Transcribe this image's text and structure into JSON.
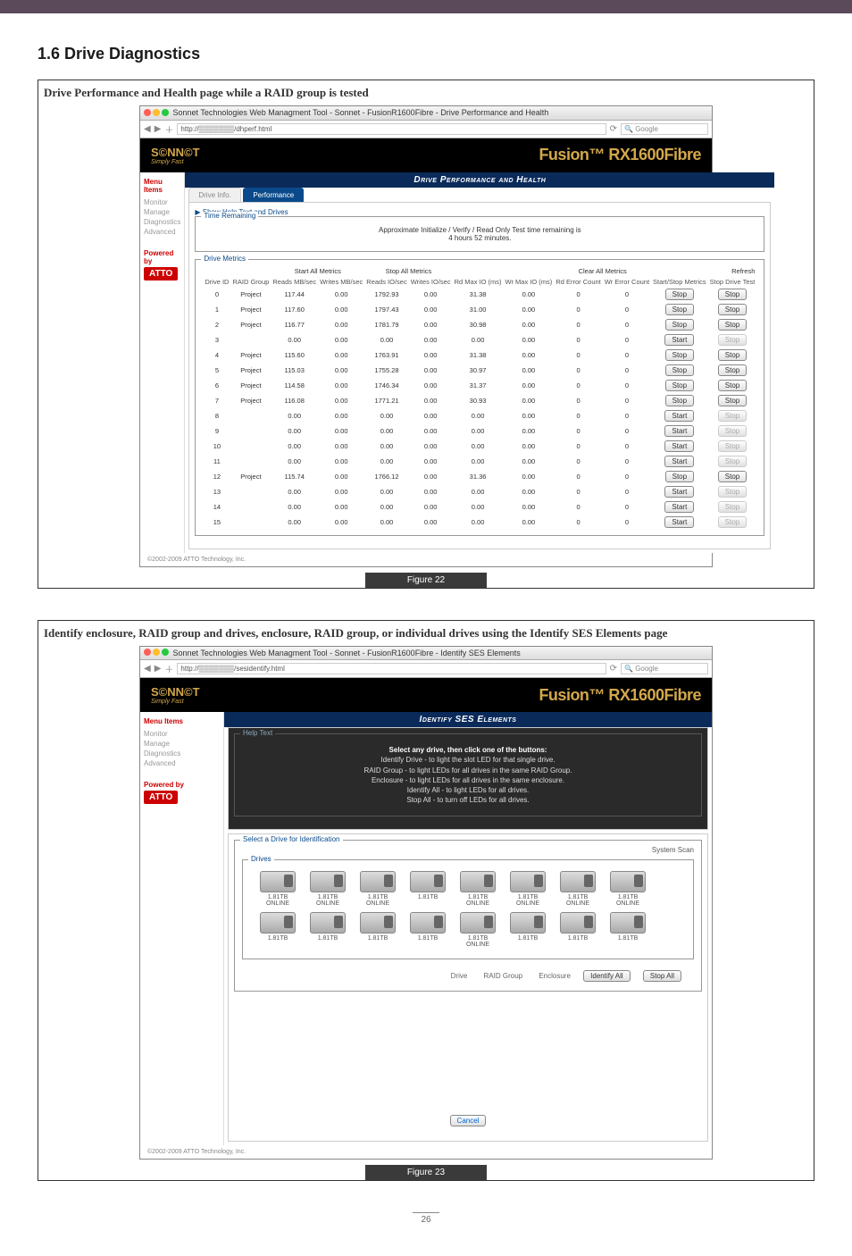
{
  "page": {
    "section_title": "1.6 Drive Diagnostics",
    "page_number": "26"
  },
  "fig1": {
    "caption": "Drive Performance and Health page while a RAID group is tested",
    "window_title": "Sonnet Technologies Web Managment Tool - Sonnet - FusionR1600Fibre - Drive Performance and Health",
    "url": "http://▒▒▒▒▒▒▒/dhperf.html",
    "search_placeholder": "Google",
    "brand": "S©NN©T",
    "brand_sub": "Simply Fast",
    "product": "Fusion™ RX1600Fibre",
    "sidebar": {
      "header": "Menu Items",
      "items": [
        "Monitor",
        "Manage",
        "Diagnostics",
        "Advanced"
      ],
      "powered": "Powered by",
      "atto": "ATTO"
    },
    "blueheader": "Drive Performance and Health",
    "tabs": [
      "Drive Info.",
      "Performance"
    ],
    "show_help": "Show Help Text and Drives",
    "time_remaining": {
      "legend": "Time Remaining",
      "line1": "Approximate Initialize / Verify / Read Only Test time remaining is",
      "line2": "4 hours 52 minutes."
    },
    "metrics": {
      "legend": "Drive Metrics",
      "group_headers": [
        "Start All Metrics",
        "Stop All Metrics",
        "Clear All Metrics",
        "Refresh"
      ],
      "cols": [
        "Drive ID",
        "RAID Group",
        "Reads MB/sec",
        "Writes MB/sec",
        "Reads IO/sec",
        "Writes IO/sec",
        "Rd Max IO (ms)",
        "Wr Max IO (ms)",
        "Rd Error Count",
        "Wr Error Count",
        "Start/Stop Metrics",
        "Stop Drive Test"
      ],
      "rows": [
        {
          "id": "0",
          "grp": "Project",
          "r": "117.44",
          "w": "0.00",
          "rio": "1792.93",
          "wio": "0.00",
          "rmax": "31.38",
          "wmax": "0.00",
          "re": "0",
          "we": "0",
          "ss": "Stop",
          "dt": "Stop"
        },
        {
          "id": "1",
          "grp": "Project",
          "r": "117.60",
          "w": "0.00",
          "rio": "1797.43",
          "wio": "0.00",
          "rmax": "31.00",
          "wmax": "0.00",
          "re": "0",
          "we": "0",
          "ss": "Stop",
          "dt": "Stop"
        },
        {
          "id": "2",
          "grp": "Project",
          "r": "116.77",
          "w": "0.00",
          "rio": "1781.79",
          "wio": "0.00",
          "rmax": "30.98",
          "wmax": "0.00",
          "re": "0",
          "we": "0",
          "ss": "Stop",
          "dt": "Stop"
        },
        {
          "id": "3",
          "grp": "",
          "r": "0.00",
          "w": "0.00",
          "rio": "0.00",
          "wio": "0.00",
          "rmax": "0.00",
          "wmax": "0.00",
          "re": "0",
          "we": "0",
          "ss": "Start",
          "dt": "Stop",
          "dis": true
        },
        {
          "id": "4",
          "grp": "Project",
          "r": "115.60",
          "w": "0.00",
          "rio": "1763.91",
          "wio": "0.00",
          "rmax": "31.38",
          "wmax": "0.00",
          "re": "0",
          "we": "0",
          "ss": "Stop",
          "dt": "Stop"
        },
        {
          "id": "5",
          "grp": "Project",
          "r": "115.03",
          "w": "0.00",
          "rio": "1755.28",
          "wio": "0.00",
          "rmax": "30.97",
          "wmax": "0.00",
          "re": "0",
          "we": "0",
          "ss": "Stop",
          "dt": "Stop"
        },
        {
          "id": "6",
          "grp": "Project",
          "r": "114.58",
          "w": "0.00",
          "rio": "1746.34",
          "wio": "0.00",
          "rmax": "31.37",
          "wmax": "0.00",
          "re": "0",
          "we": "0",
          "ss": "Stop",
          "dt": "Stop"
        },
        {
          "id": "7",
          "grp": "Project",
          "r": "116.08",
          "w": "0.00",
          "rio": "1771.21",
          "wio": "0.00",
          "rmax": "30.93",
          "wmax": "0.00",
          "re": "0",
          "we": "0",
          "ss": "Stop",
          "dt": "Stop"
        },
        {
          "id": "8",
          "grp": "",
          "r": "0.00",
          "w": "0.00",
          "rio": "0.00",
          "wio": "0.00",
          "rmax": "0.00",
          "wmax": "0.00",
          "re": "0",
          "we": "0",
          "ss": "Start",
          "dt": "Stop",
          "dis": true
        },
        {
          "id": "9",
          "grp": "",
          "r": "0.00",
          "w": "0.00",
          "rio": "0.00",
          "wio": "0.00",
          "rmax": "0.00",
          "wmax": "0.00",
          "re": "0",
          "we": "0",
          "ss": "Start",
          "dt": "Stop",
          "dis": true
        },
        {
          "id": "10",
          "grp": "",
          "r": "0.00",
          "w": "0.00",
          "rio": "0.00",
          "wio": "0.00",
          "rmax": "0.00",
          "wmax": "0.00",
          "re": "0",
          "we": "0",
          "ss": "Start",
          "dt": "Stop",
          "dis": true
        },
        {
          "id": "11",
          "grp": "",
          "r": "0.00",
          "w": "0.00",
          "rio": "0.00",
          "wio": "0.00",
          "rmax": "0.00",
          "wmax": "0.00",
          "re": "0",
          "we": "0",
          "ss": "Start",
          "dt": "Stop",
          "dis": true
        },
        {
          "id": "12",
          "grp": "Project",
          "r": "115.74",
          "w": "0.00",
          "rio": "1766.12",
          "wio": "0.00",
          "rmax": "31.36",
          "wmax": "0.00",
          "re": "0",
          "we": "0",
          "ss": "Stop",
          "dt": "Stop"
        },
        {
          "id": "13",
          "grp": "",
          "r": "0.00",
          "w": "0.00",
          "rio": "0.00",
          "wio": "0.00",
          "rmax": "0.00",
          "wmax": "0.00",
          "re": "0",
          "we": "0",
          "ss": "Start",
          "dt": "Stop",
          "dis": true
        },
        {
          "id": "14",
          "grp": "",
          "r": "0.00",
          "w": "0.00",
          "rio": "0.00",
          "wio": "0.00",
          "rmax": "0.00",
          "wmax": "0.00",
          "re": "0",
          "we": "0",
          "ss": "Start",
          "dt": "Stop",
          "dis": true
        },
        {
          "id": "15",
          "grp": "",
          "r": "0.00",
          "w": "0.00",
          "rio": "0.00",
          "wio": "0.00",
          "rmax": "0.00",
          "wmax": "0.00",
          "re": "0",
          "we": "0",
          "ss": "Start",
          "dt": "Stop",
          "dis": true
        }
      ]
    },
    "footer": "©2002-2009 ATTO Technology, Inc.",
    "fig_label": "Figure 22"
  },
  "fig2": {
    "caption": "Identify enclosure, RAID group and drives, enclosure, RAID group, or individual drives using the Identify SES Elements page",
    "window_title": "Sonnet Technologies Web Managment Tool - Sonnet - FusionR1600Fibre - Identify SES Elements",
    "url": "http://▒▒▒▒▒▒▒/sesidentify.html",
    "search_placeholder": "Google",
    "blueheader": "Identify SES Elements",
    "help": {
      "legend": "Help Text",
      "l1": "Select any drive, then click one of the buttons:",
      "l2": "Identify Drive - to light the slot LED for that single drive.",
      "l3": "RAID Group - to light LEDs for all drives in the same RAID Group.",
      "l4": "Enclosure - to light LEDs for all drives in the same enclosure.",
      "l5": "Identify All - to light LEDs for all drives.",
      "l6": "Stop All - to turn off LEDs for all drives."
    },
    "select": {
      "legend": "Select a Drive for Identification",
      "scan": "System Scan",
      "drives_legend": "Drives"
    },
    "drives": [
      {
        "size": "1.81TB",
        "state": "ONLINE"
      },
      {
        "size": "1.81TB",
        "state": "ONLINE"
      },
      {
        "size": "1.81TB",
        "state": "ONLINE"
      },
      {
        "size": "1.81TB",
        "state": ""
      },
      {
        "size": "1.81TB",
        "state": "ONLINE"
      },
      {
        "size": "1.81TB",
        "state": "ONLINE"
      },
      {
        "size": "1.81TB",
        "state": "ONLINE"
      },
      {
        "size": "1.81TB",
        "state": "ONLINE"
      },
      {
        "size": "1.81TB",
        "state": ""
      },
      {
        "size": "1.81TB",
        "state": ""
      },
      {
        "size": "1.81TB",
        "state": ""
      },
      {
        "size": "1.81TB",
        "state": ""
      },
      {
        "size": "1.81TB",
        "state": "ONLINE"
      },
      {
        "size": "1.81TB",
        "state": ""
      },
      {
        "size": "1.81TB",
        "state": ""
      },
      {
        "size": "1.81TB",
        "state": ""
      }
    ],
    "idbtns": {
      "drive": "Drive",
      "raid": "RAID Group",
      "enc": "Enclosure",
      "all": "Identify All",
      "stop": "Stop All"
    },
    "cancel": "Cancel",
    "fig_label": "Figure 23"
  }
}
